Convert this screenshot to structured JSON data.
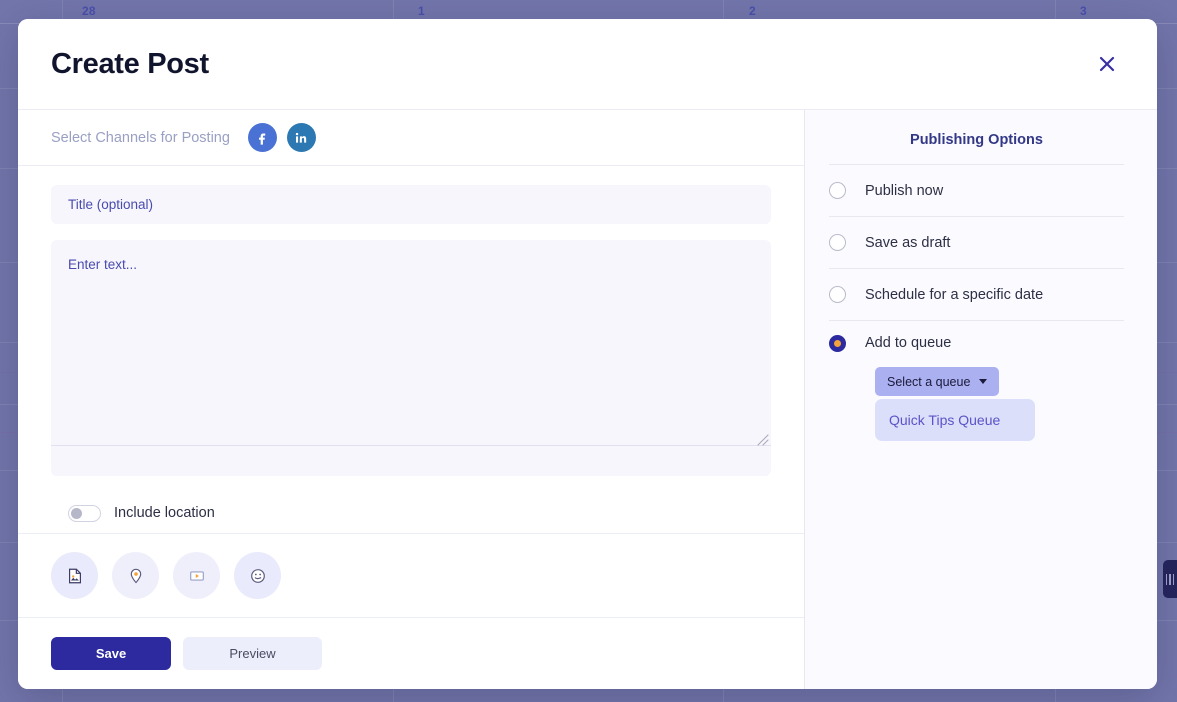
{
  "background": {
    "calendar_dates": [
      "28",
      "1",
      "2",
      "3"
    ],
    "overlay_color": "#7376ab"
  },
  "modal": {
    "title": "Create Post",
    "close_icon": "close-icon"
  },
  "channels": {
    "label": "Select Channels for Posting",
    "items": [
      {
        "name": "facebook",
        "glyph": "f",
        "color": "#4a72d4"
      },
      {
        "name": "linkedin",
        "glyph": "in",
        "color": "#2c78b3"
      }
    ]
  },
  "composer": {
    "title_placeholder": "Title (optional)",
    "title_value": "",
    "text_placeholder": "Enter text...",
    "text_value": "",
    "include_location_label": "Include location",
    "include_location_on": false
  },
  "tools": [
    {
      "name": "image-icon",
      "label": "Add image"
    },
    {
      "name": "location-pin-icon",
      "label": "Add location"
    },
    {
      "name": "video-icon",
      "label": "Add video"
    },
    {
      "name": "emoji-icon",
      "label": "Add emoji"
    }
  ],
  "actions": {
    "save_label": "Save",
    "preview_label": "Preview",
    "save_color": "#2c2a9e",
    "preview_color": "#edeefb"
  },
  "publishing": {
    "title": "Publishing Options",
    "options": [
      {
        "label": "Publish now",
        "selected": false
      },
      {
        "label": "Save as draft",
        "selected": false
      },
      {
        "label": "Schedule for a specific date",
        "selected": false
      },
      {
        "label": "Add to queue",
        "selected": true
      }
    ],
    "queue_select_label": "Select a queue",
    "queue_menu_items": [
      "Quick Tips Queue"
    ],
    "selected_radio_color": "#2c2a9e",
    "selected_radio_dot_color": "#f3a33a"
  }
}
